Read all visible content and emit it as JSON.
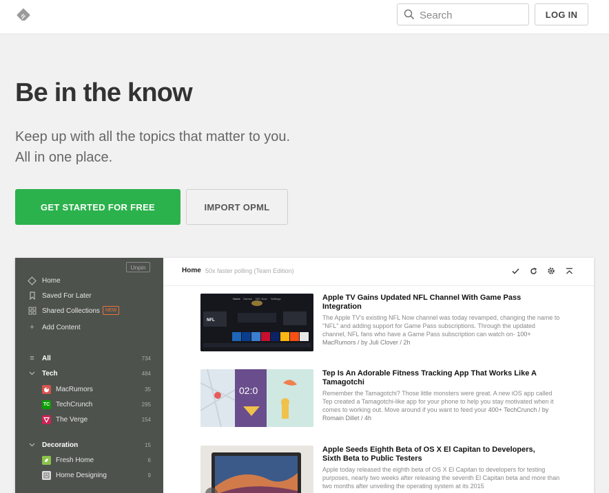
{
  "header": {
    "search_placeholder": "Search",
    "login_label": "LOG IN"
  },
  "hero": {
    "title": "Be in the know",
    "subtitle_line1": "Keep up with all the topics that matter to you.",
    "subtitle_line2": "All in one place.",
    "primary_cta": "GET STARTED FOR FREE",
    "secondary_cta": "IMPORT OPML"
  },
  "colors": {
    "accent_green": "#2bb24c",
    "sidebar_bg": "#4e524d",
    "new_badge": "#e8743b"
  },
  "app": {
    "unpin_label": "Unpin",
    "nav": [
      {
        "label": "Home",
        "icon": "home-icon"
      },
      {
        "label": "Saved For Later",
        "icon": "bookmark-icon"
      },
      {
        "label": "Shared Collections",
        "icon": "collections-icon",
        "badge": "NEW"
      },
      {
        "label": "Add Content",
        "icon": "plus-icon"
      }
    ],
    "all": {
      "label": "All",
      "count": "734"
    },
    "tech": {
      "label": "Tech",
      "count": "484"
    },
    "tech_feeds": [
      {
        "label": "MacRumors",
        "count": "35",
        "icon": "macrumors-icon"
      },
      {
        "label": "TechCrunch",
        "count": "295",
        "icon": "techcrunch-icon",
        "abbr": "TC"
      },
      {
        "label": "The Verge",
        "count": "154",
        "icon": "verge-icon"
      }
    ],
    "decoration": {
      "label": "Decoration",
      "count": "15"
    },
    "decoration_feeds": [
      {
        "label": "Fresh Home",
        "count": "6",
        "icon": "freshhome-icon"
      },
      {
        "label": "Home Designing",
        "count": "9",
        "icon": "homedesigning-icon"
      }
    ],
    "main_title": "Home",
    "main_subtitle": "50x faster polling (Team Edition)",
    "articles": [
      {
        "title": "Apple TV Gains Updated NFL Channel With Game Pass Integration",
        "body": "The Apple TV's existing NFL Now channel was today revamped, changing the name to \"NFL\" and adding support for Game Pass subscriptions. Through the updated channel, NFL fans who have a Game Pass subscription can watch on-",
        "count": "100+",
        "meta": "MacRumors / by Juli Clover / 2h"
      },
      {
        "title": "Tep Is An Adorable Fitness Tracking App That Works Like A Tamagotchi",
        "body": "Remember the Tamagotchi? Those little monsters were great. A new iOS app called Tep created a Tamagotchi-like app for your phone to help you stay motivated when it comes to working out. Move around if you want to feed your",
        "count": "400+",
        "meta": "TechCrunch / by Romain Dillet / 4h"
      },
      {
        "title": "Apple Seeds Eighth Beta of OS X El Capitan to Developers, Sixth Beta to Public Testers",
        "body": "Apple today released the eighth beta of OS X El Capitan to developers for testing purposes, nearly two weeks after releasing the seventh El Capitan beta and more than two months after unveiling the operating system at its 2015",
        "count": "",
        "meta": ""
      }
    ],
    "thumb_text": {
      "tv_tabs": [
        "Home",
        "Games",
        "NFL Now",
        "Settings"
      ],
      "tv_logo": "NFL",
      "tep_clock": "02:0"
    }
  }
}
